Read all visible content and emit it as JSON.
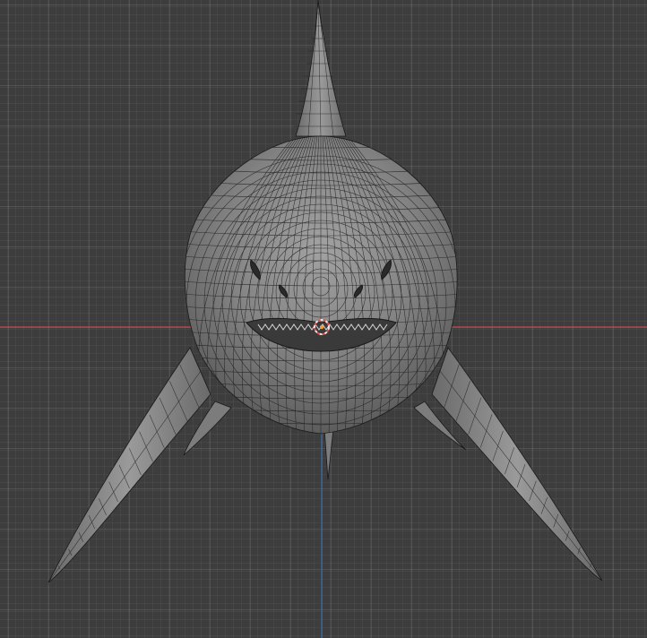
{
  "viewport": {
    "mode": "wireframe-overlay",
    "object": "shark-mesh",
    "colors": {
      "background": "#3d3d3d",
      "grid_minor": "#444444",
      "grid_major": "#4c4c4c",
      "x_axis": "#c4474f",
      "y_axis": "#3d6ea8",
      "mesh_fill": "#8a8a8a",
      "mesh_wire": "#1a1a1a",
      "cursor_ring": "#e8e8e8",
      "cursor_accent": "#e05050"
    },
    "icons": {
      "cursor": "3d-cursor-icon"
    }
  }
}
